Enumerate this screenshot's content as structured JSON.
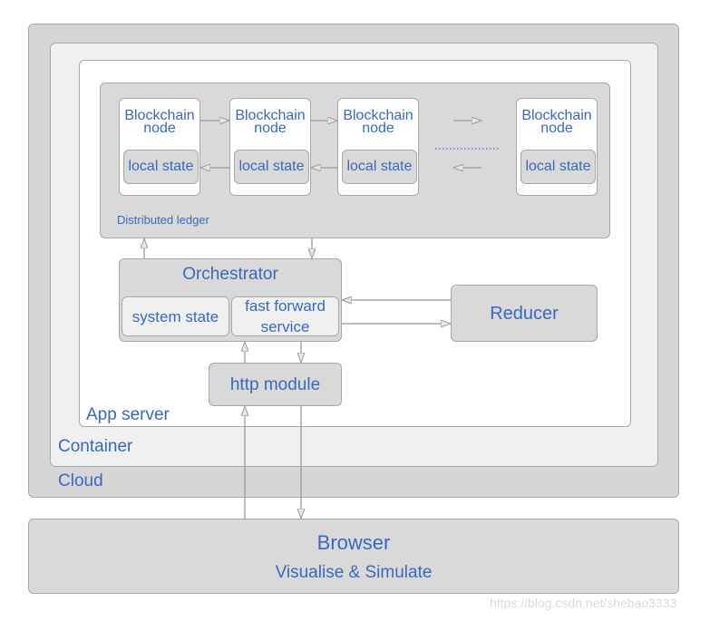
{
  "cloud": {
    "label": "Cloud"
  },
  "container": {
    "label": "Container"
  },
  "app_server": {
    "label": "App server"
  },
  "ledger": {
    "label": "Distributed ledger",
    "nodes": [
      {
        "title": "Blockchain node",
        "state": "local state"
      },
      {
        "title": "Blockchain node",
        "state": "local state"
      },
      {
        "title": "Blockchain node",
        "state": "local state"
      },
      {
        "title": "Blockchain node",
        "state": "local state"
      }
    ]
  },
  "orchestrator": {
    "label": "Orchestrator",
    "system_state": "system state",
    "fast_forward": "fast forward service"
  },
  "reducer": {
    "label": "Reducer"
  },
  "http": {
    "label": "http module"
  },
  "browser": {
    "label": "Browser",
    "sub": "Visualise & Simulate"
  },
  "watermark": "https://blog.csdn.net/shebao3333",
  "colors": {
    "text": "#3a68c0",
    "cloud": "#d6d6d6",
    "container": "#f0f0f0",
    "ledger": "#d9d9d9"
  }
}
